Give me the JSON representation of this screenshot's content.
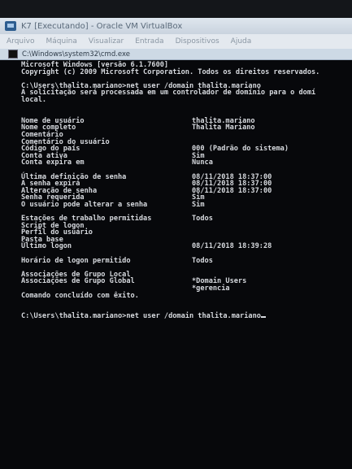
{
  "vbox": {
    "title": "K7 [Executando] - Oracle VM VirtualBox",
    "menu": [
      "Arquivo",
      "Máquina",
      "Visualizar",
      "Entrada",
      "Dispositivos",
      "Ajuda"
    ]
  },
  "cmd": {
    "title": "C:\\Windows\\system32\\cmd.exe"
  },
  "console": {
    "header": [
      "Microsoft Windows [versão 6.1.7600]",
      "Copyright (c) 2009 Microsoft Corporation. Todos os direitos reservados."
    ],
    "command1": "C:\\Users\\thalita.mariano>net user /domain thalita.mariano",
    "request": [
      "A solicitação será processada em um controlador de domínio para o domí",
      "local."
    ],
    "block1": [
      {
        "label": "Nome de usuário",
        "value": "thalita.mariano"
      },
      {
        "label": "Nome completo",
        "value": "Thalita Mariano"
      },
      {
        "label": "Comentário",
        "value": ""
      },
      {
        "label": "Comentário do usuário",
        "value": ""
      },
      {
        "label": "Código do país",
        "value": "000 (Padrão do sistema)"
      },
      {
        "label": "Conta ativa",
        "value": "Sim"
      },
      {
        "label": "Conta expira em",
        "value": "Nunca"
      }
    ],
    "block2": [
      {
        "label": "Última definição de senha",
        "value": "08/11/2018 18:37:00"
      },
      {
        "label": "A senha expira",
        "value": "08/11/2018 18:37:00"
      },
      {
        "label": "Alteração de senha",
        "value": "08/11/2018 18:37:00"
      },
      {
        "label": "Senha requerida",
        "value": "Sim"
      },
      {
        "label": "O usuário pode alterar a senha",
        "value": "Sim"
      }
    ],
    "block3": [
      {
        "label": "Estações de trabalho permitidas",
        "value": "Todos"
      },
      {
        "label": "Script de logon",
        "value": ""
      },
      {
        "label": "Perfil do usuário",
        "value": ""
      },
      {
        "label": "Pasta base",
        "value": ""
      },
      {
        "label": "Último logon",
        "value": "08/11/2018 18:39:28"
      }
    ],
    "block4": [
      {
        "label": "Horário de logon permitido",
        "value": "Todos"
      }
    ],
    "block5": [
      {
        "label": "Associações de Grupo Local",
        "value": ""
      },
      {
        "label": "Associações de Grupo Global",
        "value": "*Domain Users"
      },
      {
        "label": "",
        "value": "*gerencia"
      }
    ],
    "done": "Comando concluído com êxito.",
    "prompt": "C:\\Users\\thalita.mariano>net user /domain thalita.mariano"
  },
  "colors": {
    "console_bg": "#07080b",
    "console_text": "#d6d9de",
    "titlebar": "#cdd9e5"
  }
}
